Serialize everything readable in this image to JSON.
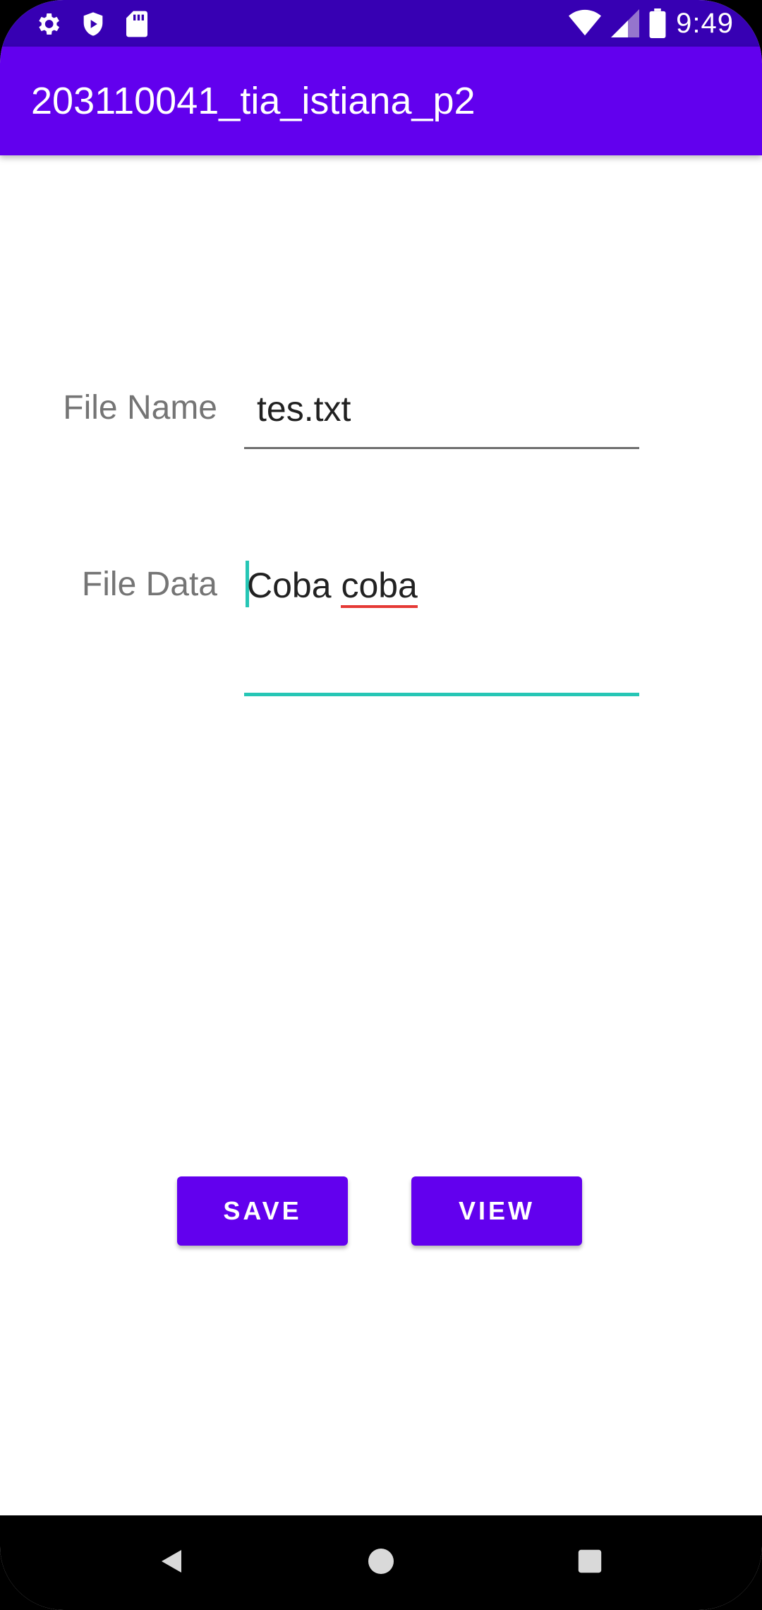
{
  "status_bar": {
    "time": "9:49",
    "left_icons": [
      "settings-icon",
      "play-protect-icon",
      "sd-card-icon"
    ],
    "right_icons": [
      "wifi-icon",
      "cellular-signal-icon",
      "battery-icon"
    ]
  },
  "app_bar": {
    "title": "203110041_tia_istiana_p2"
  },
  "form": {
    "file_name_label": "File Name",
    "file_name_value": "tes.txt",
    "file_data_label": "File Data",
    "file_data_value_word1": "Coba ",
    "file_data_value_word2": "coba"
  },
  "buttons": {
    "save_label": "SAVE",
    "view_label": "VIEW"
  },
  "nav_bar": {
    "icons": [
      "back-icon",
      "home-icon",
      "recents-icon"
    ]
  },
  "colors": {
    "status_bar": "#3700b3",
    "primary": "#6200ee",
    "accent": "#26c6b5",
    "spellcheck": "#e53935"
  }
}
